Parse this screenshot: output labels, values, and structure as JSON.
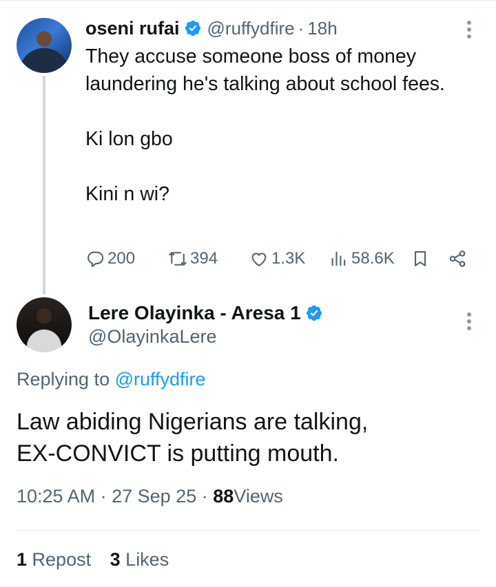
{
  "parent_tweet": {
    "author_name": "oseni rufai",
    "handle": "@ruffydfire",
    "separator": "·",
    "time_ago": "18h",
    "text_lines": [
      "They accuse someone boss of money laundering he's talking about school fees.",
      "Ki lon gbo",
      "Kini n wi?"
    ],
    "actions": {
      "replies": "200",
      "reposts": "394",
      "likes": "1.3K",
      "views": "58.6K"
    },
    "icons": [
      "verified-badge-icon",
      "more-icon",
      "reply-icon",
      "repost-icon",
      "like-icon",
      "views-icon",
      "bookmark-icon",
      "share-icon"
    ]
  },
  "reply_tweet": {
    "author_name": "Lere Olayinka - Aresa 1",
    "handle": "@OlayinkaLere",
    "replying_prefix": "Replying to",
    "replying_to": "@ruffydfire",
    "text_lines": [
      "Law abiding Nigerians are talking,",
      "EX-CONVICT is putting mouth."
    ],
    "time": "10:25 AM",
    "date": "27 Sep 25",
    "separator": "·",
    "views_count": "88",
    "views_label": "Views",
    "reposts_count": "1",
    "reposts_label": "Repost",
    "likes_count": "3",
    "likes_label": "Likes"
  },
  "colors": {
    "text_primary": "#0f1419",
    "text_secondary": "#536471",
    "accent": "#1d9bf0",
    "thread_line": "#cfd9de"
  }
}
